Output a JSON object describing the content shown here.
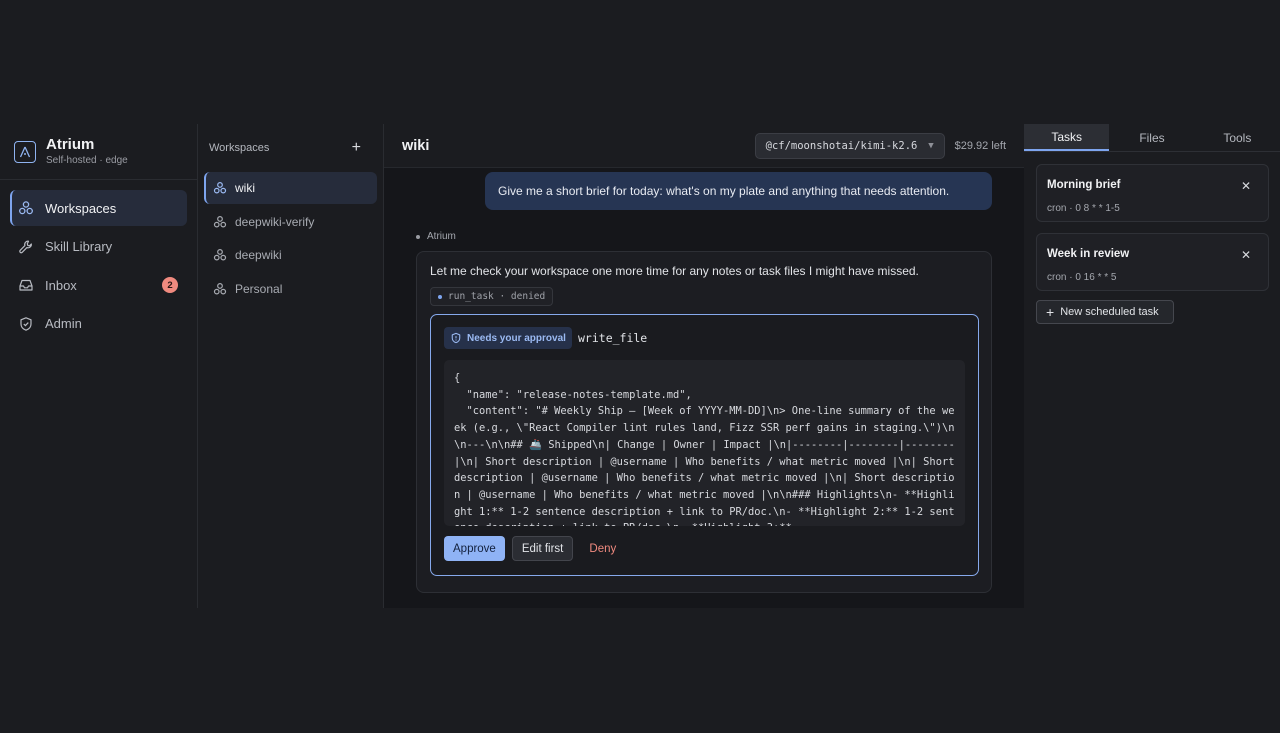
{
  "brand": {
    "title": "Atrium",
    "subtitle": "Self-hosted · edge"
  },
  "nav": {
    "items": [
      {
        "label": "Workspaces",
        "icon": "workspaces-icon"
      },
      {
        "label": "Skill Library",
        "icon": "wrench-icon"
      },
      {
        "label": "Inbox",
        "icon": "inbox-icon",
        "badge": "2"
      },
      {
        "label": "Admin",
        "icon": "shield-icon"
      }
    ]
  },
  "workspaces": {
    "heading": "Workspaces",
    "add": "+",
    "items": [
      {
        "label": "wiki"
      },
      {
        "label": "deepwiki-verify"
      },
      {
        "label": "deepwiki"
      },
      {
        "label": "Personal"
      }
    ]
  },
  "main": {
    "title": "wiki",
    "model": "@cf/moonshotai/kimi-k2.6",
    "credit": "$29.92 left",
    "user_message": "Give me a short brief for today: what's on my plate and anything that needs attention.",
    "assistant_label": "Atrium",
    "assistant_text": "Let me check your workspace one more time for any notes or task files I might have missed.",
    "tool_chip": "run_task · denied",
    "approval": {
      "badge": "Needs your approval",
      "tool": "write_file",
      "code": "{\n  \"name\": \"release-notes-template.md\",\n  \"content\": \"# Weekly Ship — [Week of YYYY-MM-DD]\\n> One-line summary of the week (e.g., \\\"React Compiler lint rules land, Fizz SSR perf gains in staging.\\\")\\n\\n---\\n\\n## 🚢 Shipped\\n| Change | Owner | Impact |\\n|--------|--------|--------|\\n| Short description | @username | Who benefits / what metric moved |\\n| Short description | @username | Who benefits / what metric moved |\\n| Short description | @username | Who benefits / what metric moved |\\n\\n### Highlights\\n- **Highlight 1:** 1-2 sentence description + link to PR/doc.\\n- **Highlight 2:** 1-2 sentence description + link to PR/doc.\\n- **Highlight 3:**",
      "approve": "Approve",
      "edit": "Edit first",
      "deny": "Deny"
    }
  },
  "right": {
    "tabs": [
      "Tasks",
      "Files",
      "Tools"
    ],
    "tasks": [
      {
        "title": "Morning brief",
        "cron": "cron · 0 8 * * 1-5"
      },
      {
        "title": "Week in review",
        "cron": "cron · 0 16 * * 5"
      }
    ],
    "close": "✕",
    "new_task": "New scheduled task"
  },
  "colors": {
    "accent": "#7ea5ef",
    "deny": "#f08a7f",
    "user_bubble": "#263553"
  }
}
